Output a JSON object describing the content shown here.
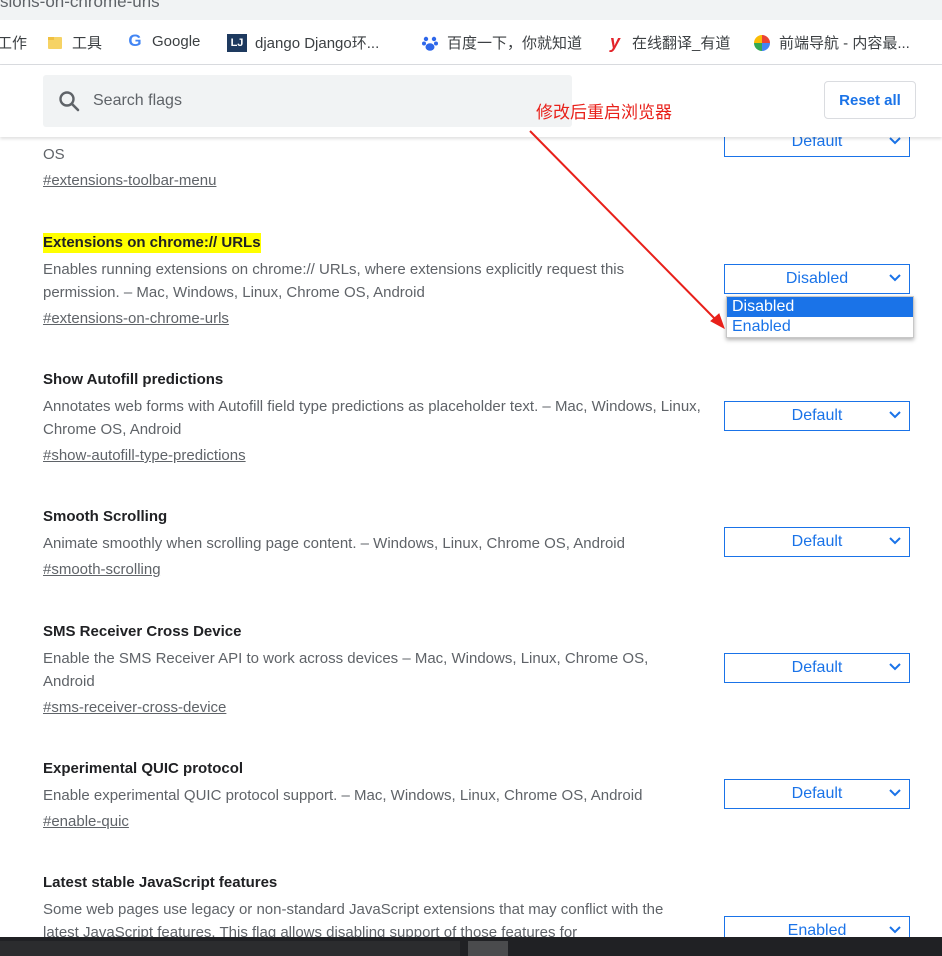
{
  "address_bar": {
    "url_fragment": "sions-on-chrome-urls"
  },
  "bookmarks": [
    {
      "label": "工作",
      "icon": "folder-icon"
    },
    {
      "label": "工具",
      "icon": "folder-icon"
    },
    {
      "label": "Google",
      "icon": "google-icon"
    },
    {
      "label": "django Django环...",
      "icon": "lj-icon"
    },
    {
      "label": "百度一下，你就知道",
      "icon": "baidu-paw-icon"
    },
    {
      "label": "在线翻译_有道",
      "icon": "youdao-icon"
    },
    {
      "label": "前端导航 - 内容最...",
      "icon": "pinwheel-icon"
    }
  ],
  "header": {
    "search_placeholder": "Search flags",
    "reset_label": "Reset all"
  },
  "annotation": {
    "text": "修改后重启浏览器",
    "color": "#e8201a"
  },
  "flags": [
    {
      "title": "",
      "description": "OS",
      "anchor": "#extensions-toolbar-menu",
      "selected": "Default"
    },
    {
      "title": "Extensions on chrome:// URLs",
      "description": "Enables running extensions on chrome:// URLs, where extensions explicitly request this permission. – Mac, Windows, Linux, Chrome OS, Android",
      "anchor": "#extensions-on-chrome-urls",
      "selected": "Disabled",
      "highlighted": true,
      "dropdown_open": true,
      "options": [
        "Disabled",
        "Enabled"
      ]
    },
    {
      "title": "Show Autofill predictions",
      "description": "Annotates web forms with Autofill field type predictions as placeholder text. – Mac, Windows, Linux, Chrome OS, Android",
      "anchor": "#show-autofill-type-predictions",
      "selected": "Default"
    },
    {
      "title": "Smooth Scrolling",
      "description": "Animate smoothly when scrolling page content. – Windows, Linux, Chrome OS, Android",
      "anchor": "#smooth-scrolling",
      "selected": "Default"
    },
    {
      "title": "SMS Receiver Cross Device",
      "description": "Enable the SMS Receiver API to work across devices – Mac, Windows, Linux, Chrome OS, Android",
      "anchor": "#sms-receiver-cross-device",
      "selected": "Default"
    },
    {
      "title": "Experimental QUIC protocol",
      "description": "Enable experimental QUIC protocol support. – Mac, Windows, Linux, Chrome OS, Android",
      "anchor": "#enable-quic",
      "selected": "Default"
    },
    {
      "title": "Latest stable JavaScript features",
      "description": "Some web pages use legacy or non-standard JavaScript extensions that may conflict with the latest JavaScript features. This flag allows disabling support of those features for",
      "anchor": "",
      "selected": "Enabled"
    }
  ],
  "colors": {
    "accent": "#1a73e8",
    "highlight": "#ffff00",
    "annotation": "#e8201a"
  }
}
